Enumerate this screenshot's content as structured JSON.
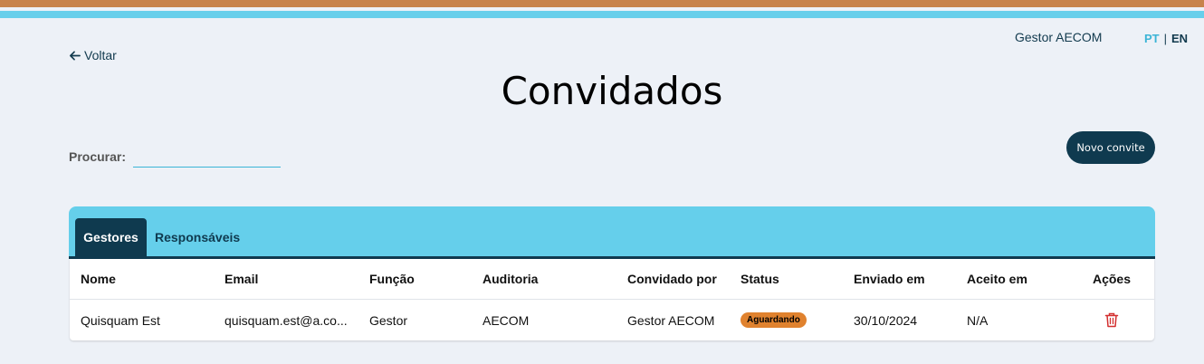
{
  "header": {
    "user_name": "Gestor AECOM",
    "lang_pt": "PT",
    "lang_sep": "|",
    "lang_en": "EN"
  },
  "back_label": "Voltar",
  "page_title": "Convidados",
  "search": {
    "label": "Procurar:",
    "value": "",
    "placeholder": ""
  },
  "new_invite_label": "Novo convite",
  "tabs": [
    {
      "label": "Gestores",
      "active": true
    },
    {
      "label": "Responsáveis",
      "active": false
    }
  ],
  "table": {
    "columns": [
      "Nome",
      "Email",
      "Função",
      "Auditoria",
      "Convidado por",
      "Status",
      "Enviado em",
      "Aceito em",
      "Ações"
    ],
    "rows": [
      {
        "nome": "Quisquam Est",
        "email": "quisquam.est@a.co...",
        "funcao": "Gestor",
        "auditoria": "AECOM",
        "convidado_por": "Gestor AECOM",
        "status": "Aguardando",
        "enviado_em": "30/10/2024",
        "aceito_em": "N/A",
        "action_icon": "trash-icon"
      }
    ]
  },
  "colors": {
    "accent_dark": "#0f3a4f",
    "accent_light": "#65cfeb",
    "stripe_orange": "#c8834b",
    "status_waiting": "#e0822e",
    "delete_red": "#d32f2f"
  }
}
